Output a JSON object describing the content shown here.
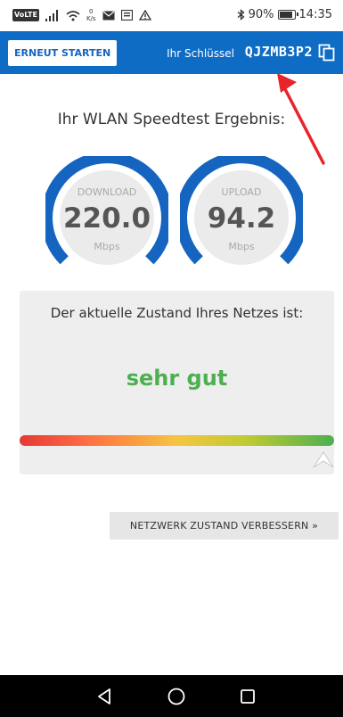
{
  "status_bar": {
    "volte": "VoLTE",
    "net_speed_value": "0",
    "net_speed_unit": "K/s",
    "battery": "90%",
    "time": "14:35"
  },
  "header": {
    "restart_label": "ERNEUT STARTEN",
    "key_label": "Ihr Schlüssel",
    "key_value": "QJZMB3P2"
  },
  "result_title": "Ihr WLAN Speedtest Ergebnis:",
  "gauges": [
    {
      "label": "DOWNLOAD",
      "value": "220.0",
      "unit": "Mbps"
    },
    {
      "label": "UPLOAD",
      "value": "94.2",
      "unit": "Mbps"
    }
  ],
  "network_state": {
    "label": "Der aktuelle Zustand Ihres Netzes ist:",
    "value": "sehr gut",
    "indicator_level": 0.98
  },
  "improve_button": "NETZWERK ZUSTAND VERBESSERN »",
  "colors": {
    "header_blue": "#0f6cc4",
    "gauge_arc": "#1565c0",
    "good_green": "#4caf50",
    "annotation_red": "#e8232a"
  },
  "icons": {
    "copy": "copy-icon",
    "annotation": "red-arrow-icon",
    "nav_back": "back-triangle-icon",
    "nav_home": "home-circle-icon",
    "nav_recents": "recents-square-icon"
  }
}
